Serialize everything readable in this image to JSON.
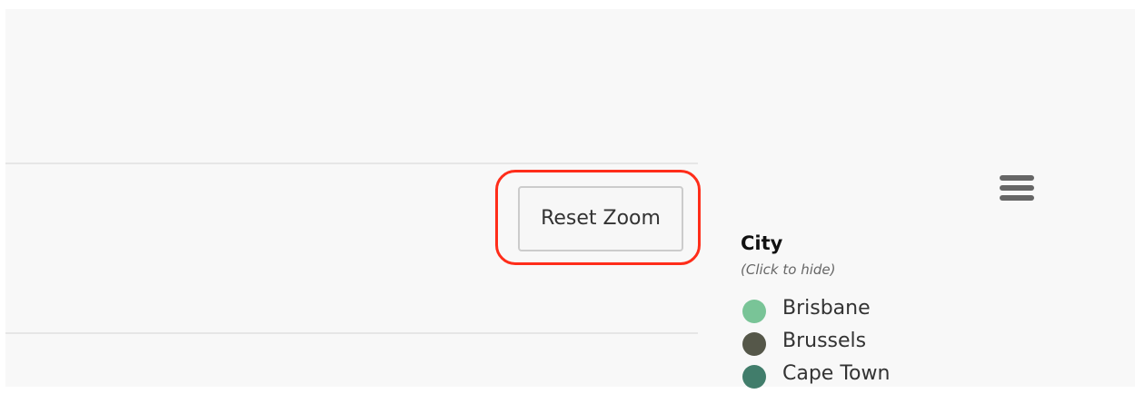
{
  "chart": {
    "reset_zoom_label": "Reset Zoom",
    "menu_icon": "hamburger-menu-icon"
  },
  "legend": {
    "title": "City",
    "subtitle": "(Click to hide)",
    "items": [
      {
        "label": "Brisbane",
        "color": "#79c497"
      },
      {
        "label": "Brussels",
        "color": "#555749"
      },
      {
        "label": "Cape Town",
        "color": "#417d6b"
      }
    ]
  },
  "highlight": {
    "color": "#ff2d1a"
  }
}
